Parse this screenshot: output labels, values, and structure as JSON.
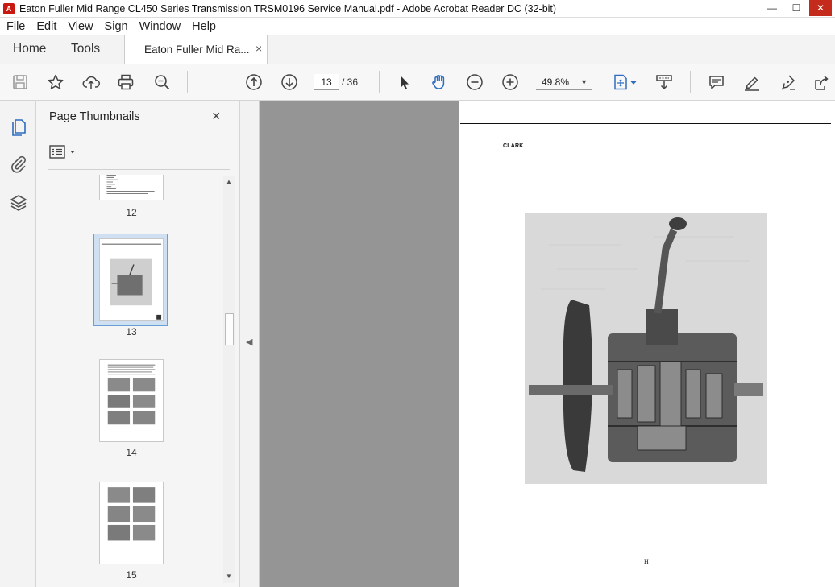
{
  "window": {
    "title": "Eaton Fuller Mid Range CL450 Series Transmission TRSM0196 Service Manual.pdf - Adobe Acrobat Reader DC (32-bit)"
  },
  "menu": {
    "items": [
      "File",
      "Edit",
      "View",
      "Sign",
      "Window",
      "Help"
    ]
  },
  "tabs": {
    "home": "Home",
    "tools": "Tools",
    "document": "Eaton Fuller Mid Ra...",
    "close_glyph": "×"
  },
  "toolbar": {
    "current_page": "13",
    "page_total": "/ 36",
    "zoom": "49.8%",
    "icons": [
      "save-icon",
      "bookmark-star-icon",
      "upload-cloud-icon",
      "print-icon",
      "zoom-search-icon",
      "page-up-icon",
      "page-down-icon",
      "select-cursor-icon",
      "hand-tool-icon",
      "zoom-out-icon",
      "zoom-in-icon",
      "fit-page-icon",
      "scroll-mode-icon",
      "comment-icon",
      "highlight-pen-icon",
      "sign-pen-icon",
      "share-icon"
    ]
  },
  "sidebar": {
    "title": "Page Thumbnails",
    "close_glyph": "×",
    "thumbnails": [
      {
        "label": "12"
      },
      {
        "label": "13"
      },
      {
        "label": "14"
      },
      {
        "label": "15"
      }
    ],
    "selected_page": "13"
  },
  "document": {
    "brand": "CLARK",
    "footer_mark": "H"
  },
  "colors": {
    "accent": "#2d6dbf",
    "doc_background": "#959595",
    "selected_thumb_border": "#6a9ed6"
  }
}
